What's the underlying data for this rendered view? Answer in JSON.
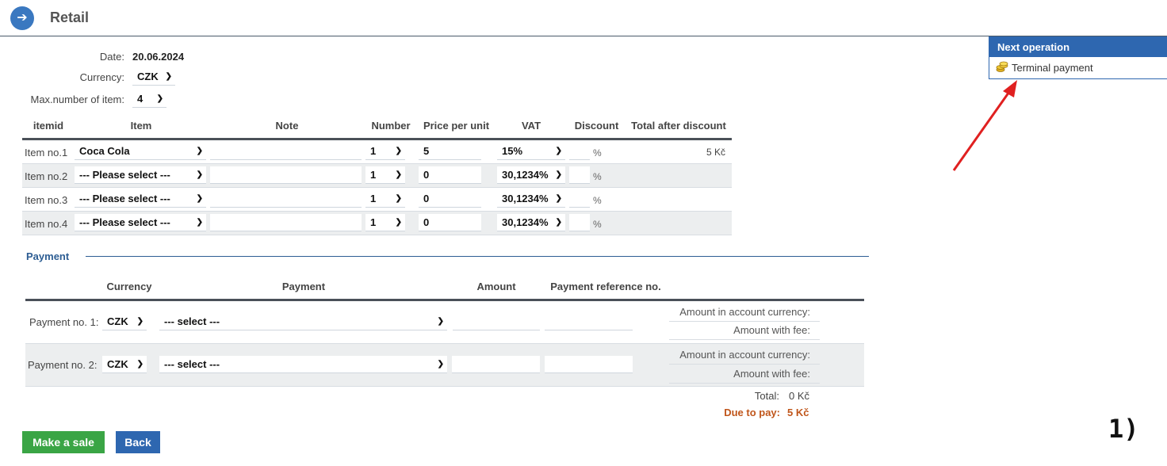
{
  "header": {
    "title": "Retail",
    "nav_icon": "arrow-right-icon"
  },
  "form": {
    "date_label": "Date:",
    "date_value": "20.06.2024",
    "currency_label": "Currency:",
    "currency_value": "CZK",
    "max_items_label": "Max.number of item:",
    "max_items_value": "4"
  },
  "items_table": {
    "headers": [
      "itemid",
      "Item",
      "Note",
      "Number",
      "Price per unit",
      "VAT",
      "Discount",
      "Total after discount"
    ],
    "rows": [
      {
        "id": "Item no.1",
        "item": "Coca Cola",
        "note": "",
        "number": "1",
        "price": "5",
        "vat": "15%",
        "discount": "",
        "pct": "%",
        "total": "5 Kč"
      },
      {
        "id": "Item no.2",
        "item": "--- Please select ---",
        "note": "",
        "number": "1",
        "price": "0",
        "vat": "30,1234%",
        "discount": "",
        "pct": "%",
        "total": ""
      },
      {
        "id": "Item no.3",
        "item": "--- Please select ---",
        "note": "",
        "number": "1",
        "price": "0",
        "vat": "30,1234%",
        "discount": "",
        "pct": "%",
        "total": ""
      },
      {
        "id": "Item no.4",
        "item": "--- Please select ---",
        "note": "",
        "number": "1",
        "price": "0",
        "vat": "30,1234%",
        "discount": "",
        "pct": "%",
        "total": ""
      }
    ]
  },
  "payment": {
    "section_title": "Payment",
    "headers": [
      "Currency",
      "Payment",
      "Amount",
      "Payment reference no."
    ],
    "rows": [
      {
        "label": "Payment no. 1:",
        "currency": "CZK",
        "method": "--- select ---",
        "amount": "",
        "reference": "",
        "acc_currency_label": "Amount in account currency:",
        "with_fee_label": "Amount with fee:"
      },
      {
        "label": "Payment no. 2:",
        "currency": "CZK",
        "method": "--- select ---",
        "amount": "",
        "reference": "",
        "acc_currency_label": "Amount in account currency:",
        "with_fee_label": "Amount with fee:"
      }
    ],
    "total_label": "Total:",
    "total_value": "0 Kč",
    "due_label": "Due to pay:",
    "due_value": "5 Kč"
  },
  "actions": {
    "make_sale": "Make a sale",
    "back": "Back"
  },
  "next_operation": {
    "title": "Next operation",
    "items": [
      {
        "label": "Terminal payment",
        "icon": "coins-icon"
      }
    ]
  },
  "annotation": {
    "step": "1)",
    "arrow_color": "#e02020"
  },
  "colors": {
    "accent": "#2e67b0",
    "green": "#3aa545",
    "due": "#c0561b"
  }
}
